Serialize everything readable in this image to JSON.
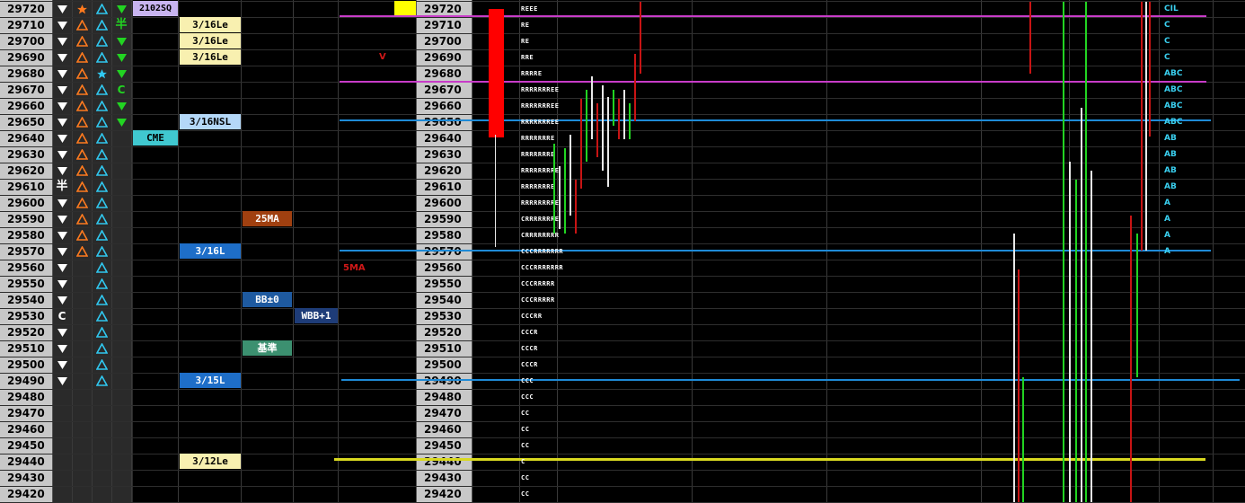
{
  "prices": [
    29720,
    29710,
    29700,
    29690,
    29680,
    29670,
    29660,
    29650,
    29640,
    29630,
    29620,
    29610,
    29600,
    29590,
    29580,
    29570,
    29560,
    29550,
    29540,
    29530,
    29520,
    29510,
    29500,
    29490,
    29480,
    29470,
    29460,
    29450,
    29440,
    29430,
    29420
  ],
  "col1_symbols": [
    "down",
    "down",
    "down",
    "down",
    "down",
    "down",
    "down",
    "down",
    "down",
    "down",
    "down",
    "han",
    "down",
    "down",
    "down",
    "down",
    "down",
    "down",
    "down",
    "C",
    "down",
    "down",
    "down",
    "down",
    "",
    "",
    "",
    "",
    "",
    "",
    ""
  ],
  "col2_symbols": [
    "star-orange",
    "up-orange",
    "up-orange",
    "up-orange",
    "up-orange",
    "up-orange",
    "up-orange",
    "up-orange",
    "up-orange",
    "up-orange",
    "up-orange",
    "up-orange",
    "up-orange",
    "up-orange",
    "up-orange",
    "up-orange",
    "",
    "",
    "",
    "",
    "",
    "",
    "",
    "",
    "",
    "",
    "",
    "",
    "",
    "",
    ""
  ],
  "col3_symbols": [
    "up-cyan",
    "up-cyan",
    "up-cyan",
    "up-cyan",
    "star-cyan",
    "up-cyan",
    "up-cyan",
    "up-cyan",
    "up-cyan",
    "up-cyan",
    "up-cyan",
    "up-cyan",
    "up-cyan",
    "up-cyan",
    "up-cyan",
    "up-cyan",
    "up-cyan",
    "up-cyan",
    "up-cyan",
    "up-cyan",
    "up-cyan",
    "up-cyan",
    "up-cyan",
    "up-cyan",
    "",
    "",
    "",
    "",
    "",
    "",
    ""
  ],
  "col4_symbols": [
    "down-green",
    "han-green",
    "down-green",
    "down-green",
    "down-green",
    "C-green",
    "down-green",
    "down-green",
    "",
    "",
    "",
    "",
    "",
    "",
    "",
    "",
    "",
    "",
    "",
    "",
    "",
    "",
    "",
    "",
    "",
    "",
    "",
    "",
    "",
    "",
    ""
  ],
  "char_han": "半",
  "char_c": "C",
  "labels": {
    "sq": "2102SQ",
    "cme": "CME",
    "le1": "3/16Le",
    "le2": "3/16Le",
    "le3": "3/16Le",
    "nsl": "3/16NSL",
    "ma25": "25MA",
    "l316": "3/16L",
    "bb0": "BB±0",
    "wbb": "WBB+1",
    "kijun": "基準",
    "l315": "3/15L",
    "le312": "3/12Le",
    "v_mark": "V",
    "ma5": "5MA"
  },
  "tpo_left": [
    "REEE",
    "RE",
    "RE",
    "RRE",
    "RRRRE",
    "RRRRRRREE",
    "RRRRRRREE",
    "RRRRRRREE",
    "RRRRRRRE",
    "RRRRRRRE",
    "RRRRRRRRE",
    "RRRRRRRE",
    "RRRRRRRRE",
    "CRRRRRRRE",
    "CRRRRRRRR",
    "CCCRRRRRRR",
    "CCCRRRRRRR",
    "CCCRRRRR",
    "CCCRRRRR",
    "CCCRR",
    "CCCR",
    "CCCR",
    "CCCR",
    "CCC",
    "CCC",
    "CC",
    "CC",
    "CC",
    "C",
    "CC",
    "CC"
  ],
  "tpo_right": [
    "CIL",
    "C",
    "C",
    "C",
    "ABC",
    "ABC",
    "ABC",
    "ABC",
    "AB",
    "AB",
    "AB",
    "AB",
    "A",
    "A",
    "A",
    "A",
    "",
    "",
    "",
    "",
    "",
    "",
    "",
    "",
    "",
    "",
    "",
    "",
    "",
    "",
    ""
  ],
  "colors": {
    "magenta": "#c83cc8",
    "blue": "#1e8ad6",
    "yellow": "#d8d820",
    "red_bar": "#ff0000"
  }
}
